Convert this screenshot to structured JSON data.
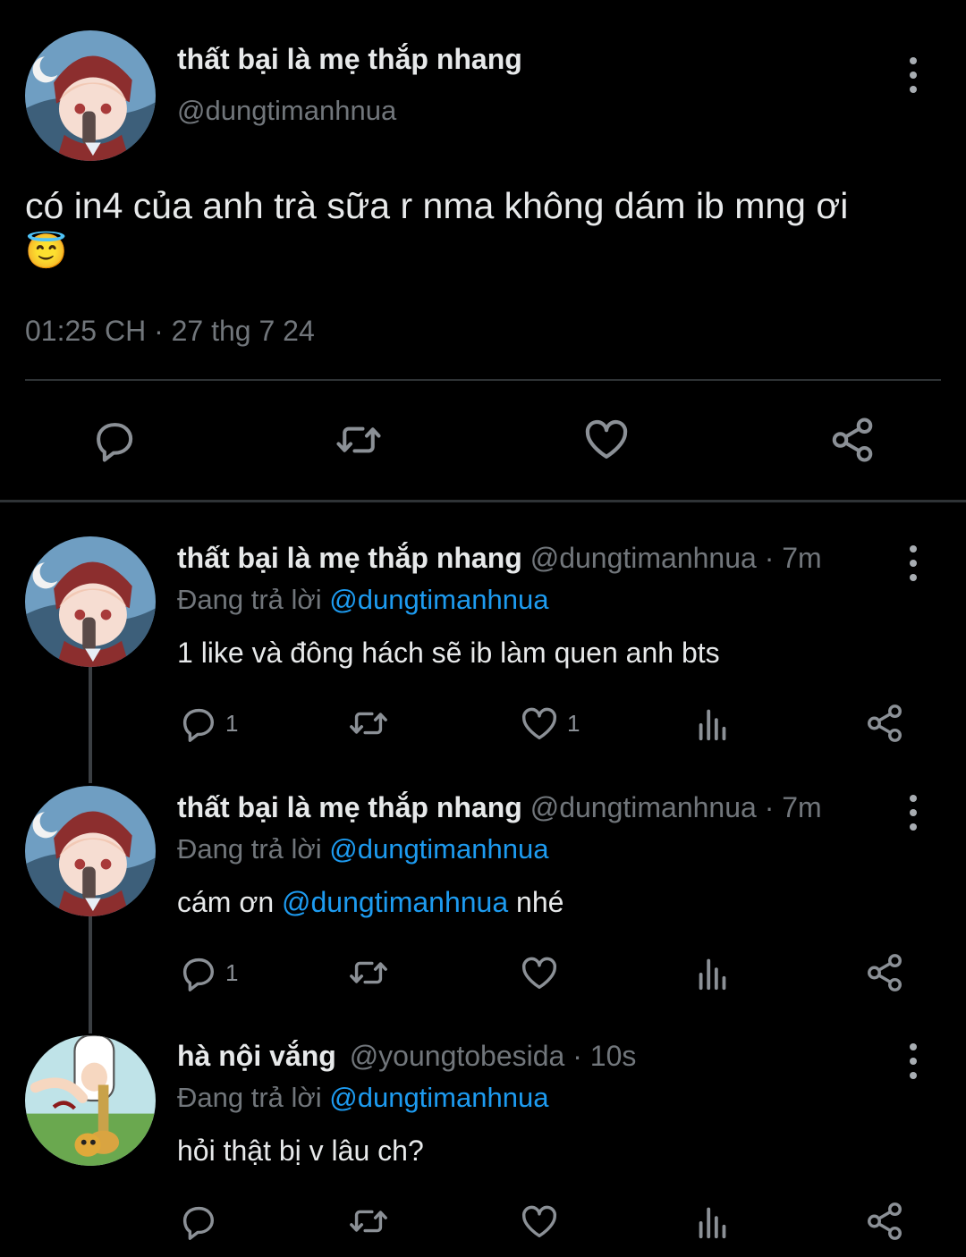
{
  "main_tweet": {
    "display_name": "thất bại là mẹ thắp nhang",
    "handle": "@dungtimanhnua",
    "text": "có in4 của anh trà sữa r nma không dám ib mng ơi",
    "emoji": "😇",
    "timestamp": "01:25 CH · 27 thg 7 24"
  },
  "replies": [
    {
      "display_name": "thất bại là mẹ thắp nhang",
      "handle": "@dungtimanhnua",
      "time": "· 7m",
      "replying_label": "Đang trả lời",
      "replying_to": "@dungtimanhnua",
      "text": "1 like và đông hách sẽ ib làm quen anh bts",
      "reply_count": "1",
      "like_count": "1"
    },
    {
      "display_name": "thất bại là mẹ thắp nhang",
      "handle": "@dungtimanhnua",
      "time": "· 7m",
      "replying_label": "Đang trả lời",
      "replying_to": "@dungtimanhnua",
      "text_before": "cám ơn",
      "mention": "@dungtimanhnua",
      "text_after": "nhé",
      "reply_count": "1"
    },
    {
      "display_name": "hà nội vắng",
      "handle": "@youngtobesida",
      "time": "· 10s",
      "replying_label": "Đang trả lời",
      "replying_to": "@dungtimanhnua",
      "text": "hỏi thật bị v lâu ch?"
    }
  ],
  "icons": [
    "reply-icon",
    "retweet-icon",
    "like-icon",
    "views-icon",
    "share-icon",
    "more-icon"
  ],
  "colors": {
    "background": "#000000",
    "text": "#e7e9ea",
    "secondary": "#71767b",
    "link": "#1d9bf0",
    "divider": "#2f3336"
  }
}
